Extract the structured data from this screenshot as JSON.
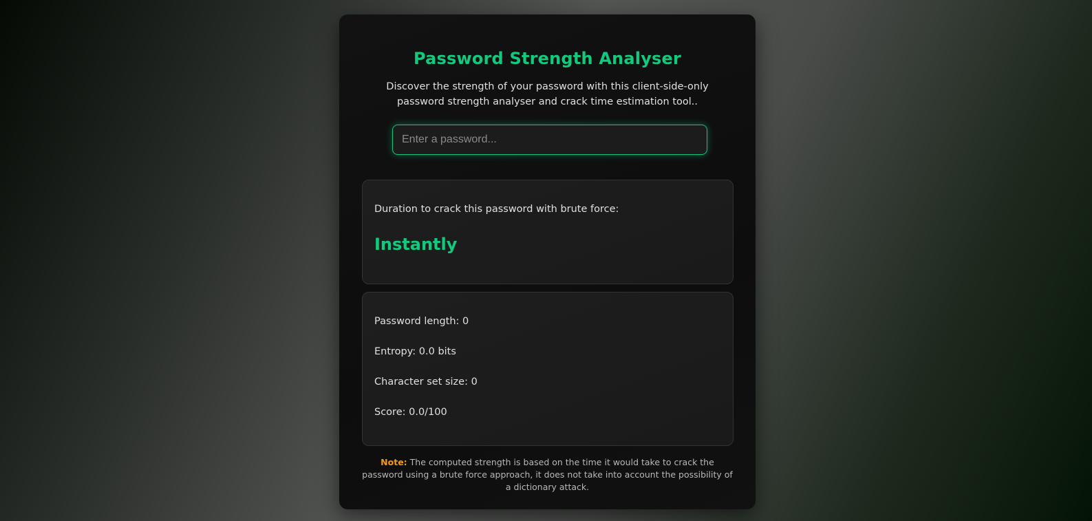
{
  "header": {
    "title": "Password Strength Analyser",
    "subtitle": "Discover the strength of your password with this client-side-only password strength analyser and crack time estimation tool.."
  },
  "password_input": {
    "value": "",
    "placeholder": "Enter a password..."
  },
  "crack_time": {
    "label": "Duration to crack this password with brute force:",
    "value": "Instantly"
  },
  "stats": {
    "length": "Password length: 0",
    "entropy": "Entropy: 0.0 bits",
    "charset": "Character set size: 0",
    "score": "Score: 0.0/100"
  },
  "note": {
    "label": "Note:",
    "text": " The computed strength is based on the time it would take to crack the password using a brute force approach, it does not take into account the possibility of a dictionary attack."
  },
  "colors": {
    "accent": "#12c97e",
    "note_label": "#f39a1c",
    "card_bg": "#0f0f0f",
    "panel_bg": "#1c1c1c"
  }
}
